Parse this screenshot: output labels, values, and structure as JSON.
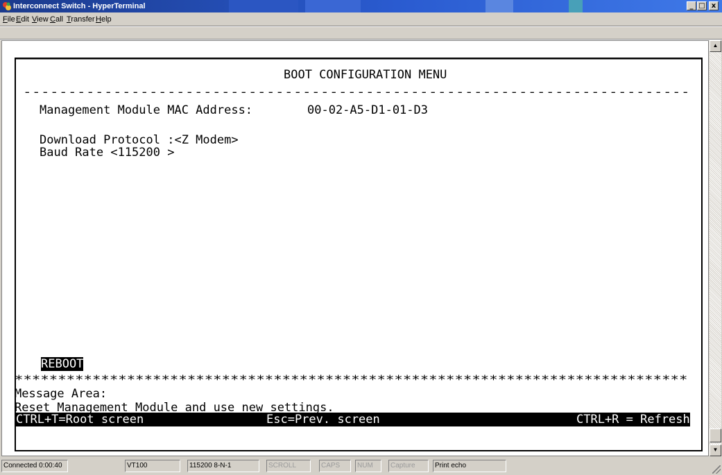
{
  "window": {
    "title": "Interconnect Switch - HyperTerminal",
    "minimize_glyph": "_",
    "maximize_glyph": "□",
    "close_glyph": "x"
  },
  "menu": [
    {
      "label": "File",
      "mnemonic": "F"
    },
    {
      "label": "Edit",
      "mnemonic": "E"
    },
    {
      "label": "View",
      "mnemonic": "V"
    },
    {
      "label": "Call",
      "mnemonic": "C"
    },
    {
      "label": "Transfer",
      "mnemonic": "T"
    },
    {
      "label": "Help",
      "mnemonic": "H"
    }
  ],
  "terminal": {
    "heading": "BOOT CONFIGURATION MENU",
    "dashes": "--------------------------------------------------------------------------",
    "mac_label": "Management Module MAC Address:",
    "mac_value": "00-02-A5-D1-01-D3",
    "download_protocol": "Download Protocol :<Z Modem>",
    "baud_rate": "Baud Rate <115200 >",
    "reboot": "REBOOT",
    "stars": "******************************************************************************",
    "message_label": "Message Area:",
    "message_text": "Reset Management Module and use new settings.",
    "help_root": "CTRL+T=Root screen",
    "help_prev": "Esc=Prev. screen",
    "help_refresh": "CTRL+R = Refresh"
  },
  "statusbar": {
    "connected": "Connected 0:00:40",
    "emulation": "VT100",
    "settings": "115200 8-N-1",
    "scroll": "SCROLL",
    "caps": "CAPS",
    "num": "NUM",
    "capture": "Capture",
    "print_echo": "Print echo"
  },
  "colors": {
    "titlebar_start": "#1b3a8c",
    "titlebar_end": "#3f79e8",
    "chrome": "#d4d0c8",
    "terminal_bg": "#ffffff"
  }
}
